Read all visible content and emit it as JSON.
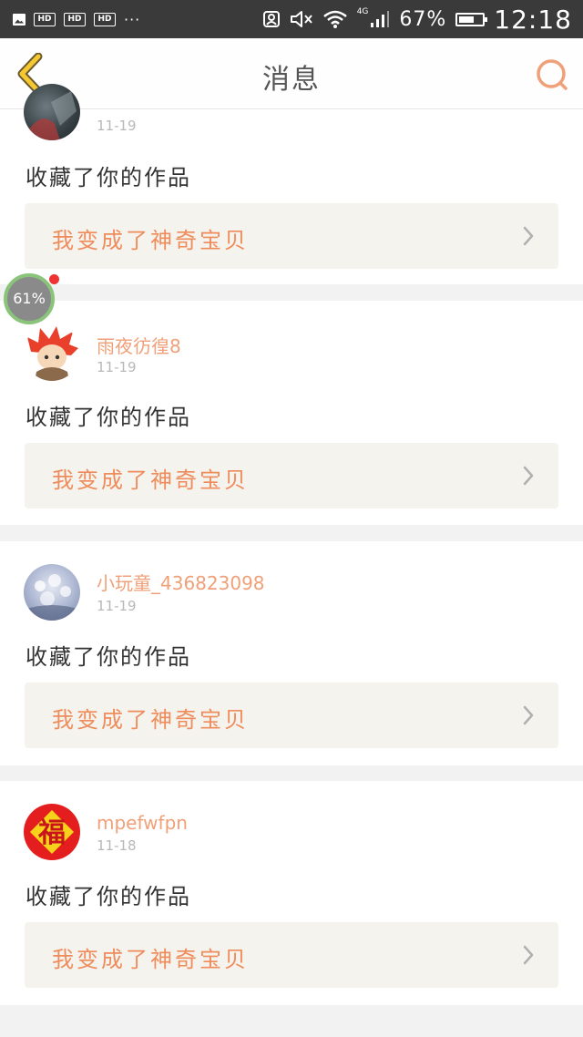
{
  "status_bar": {
    "mini_icons": [
      "HD",
      "HD",
      "HD"
    ],
    "more": "···",
    "network": "4G",
    "battery_percent": "67%",
    "battery_level": 0.67,
    "time": "12:18"
  },
  "header": {
    "title": "消息",
    "back_icon": "chevron-left-icon",
    "search_icon": "search-icon",
    "accent_color": "#f0a078"
  },
  "notifications": [
    {
      "username": "",
      "date": "11-19",
      "action": "收藏了你的作品",
      "work_title": "我变成了神奇宝贝",
      "avatar": "dark-photo"
    },
    {
      "username": "雨夜彷徨8",
      "date": "11-19",
      "action": "收藏了你的作品",
      "work_title": "我变成了神奇宝贝",
      "avatar": "red-hair-character"
    },
    {
      "username": "小玩童_436823098",
      "date": "11-19",
      "action": "收藏了你的作品",
      "work_title": "我变成了神奇宝贝",
      "avatar": "blossom-photo"
    },
    {
      "username": "mpefwfpn",
      "date": "11-18",
      "action": "收藏了你的作品",
      "work_title": "我变成了神奇宝贝",
      "avatar": "fu-character"
    }
  ],
  "floating_widget": {
    "label": "61%",
    "level": 0.61
  },
  "avatar_glyph": "福"
}
